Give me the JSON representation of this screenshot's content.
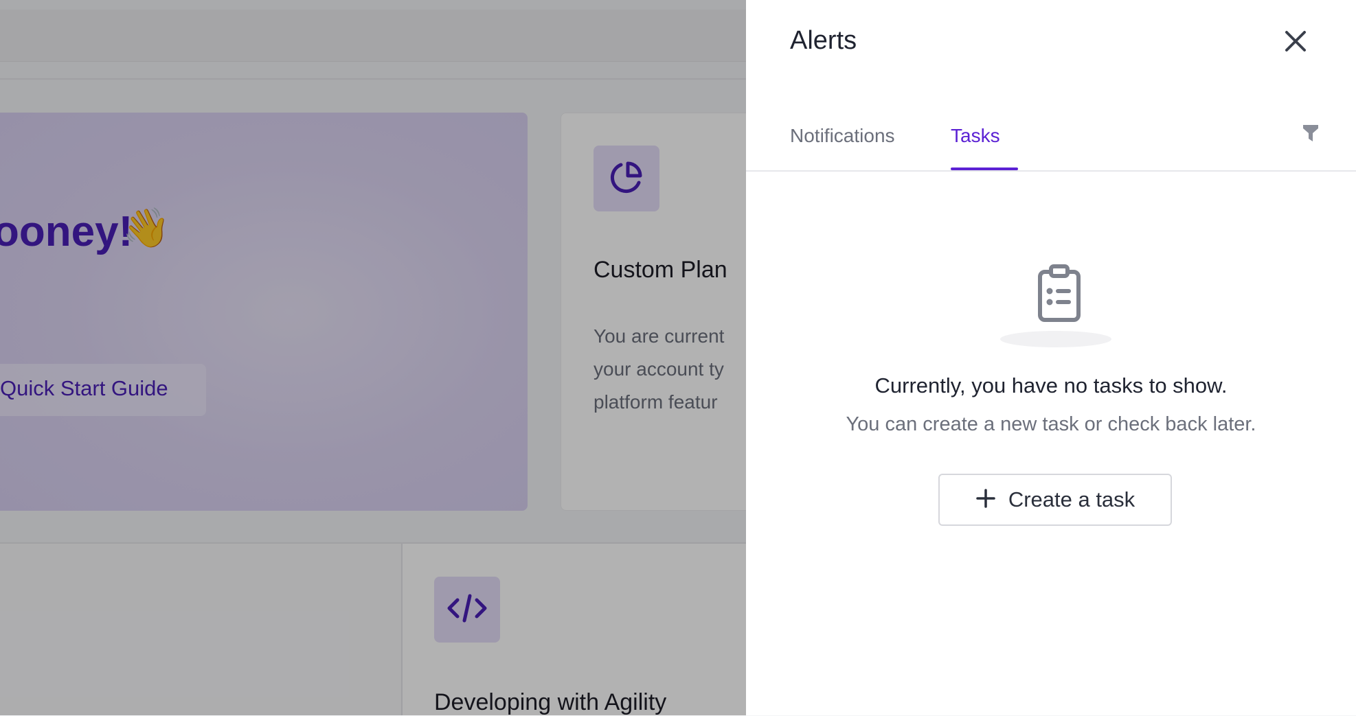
{
  "background": {
    "welcome_heading": "ooney!",
    "wave_emoji": "👋",
    "quick_start_label": "Quick Start Guide",
    "plan_card": {
      "title": "Custom Plan",
      "description_lines": [
        "You are current",
        "your account ty",
        "platform featur"
      ],
      "icon": "pie-chart-icon"
    },
    "dev_card": {
      "title": "Developing with Agility",
      "icon": "code-icon"
    }
  },
  "drawer": {
    "title": "Alerts",
    "close_icon": "close-icon",
    "tabs": [
      {
        "label": "Notifications",
        "active": false
      },
      {
        "label": "Tasks",
        "active": true
      }
    ],
    "filter_icon": "filter-icon",
    "empty_state": {
      "icon": "clipboard-icon",
      "title": "Currently, you have no tasks to show.",
      "subtitle": "You can create a new task or check back later.",
      "button_label": "Create a task",
      "button_icon": "plus-icon"
    }
  },
  "colors": {
    "accent": "#5b21d4",
    "heading_purple": "#4a1fb6",
    "icon_tile": "#e4ddf8"
  }
}
